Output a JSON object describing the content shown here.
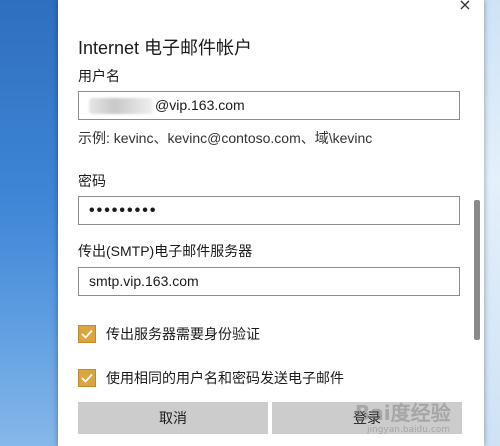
{
  "dialog": {
    "title": "Internet 电子邮件帐户",
    "username_label": "用户名",
    "username_suffix": "@vip.163.com",
    "example_hint": "示例: kevinc、kevinc@contoso.com、域\\kevinc",
    "password_label": "密码",
    "password_value": "•••••••••",
    "smtp_label": "传出(SMTP)电子邮件服务器",
    "smtp_value": "smtp.vip.163.com",
    "check1_label": "传出服务器需要身份验证",
    "check2_label": "使用相同的用户名和密码发送电子邮件",
    "cancel_label": "取消",
    "login_label": "登录",
    "close_glyph": "×"
  },
  "watermark": {
    "brand": "Bai度经验",
    "url": "jingyan.baidu.com"
  },
  "colors": {
    "checkbox": "#d9a441",
    "button": "#cccccc"
  }
}
